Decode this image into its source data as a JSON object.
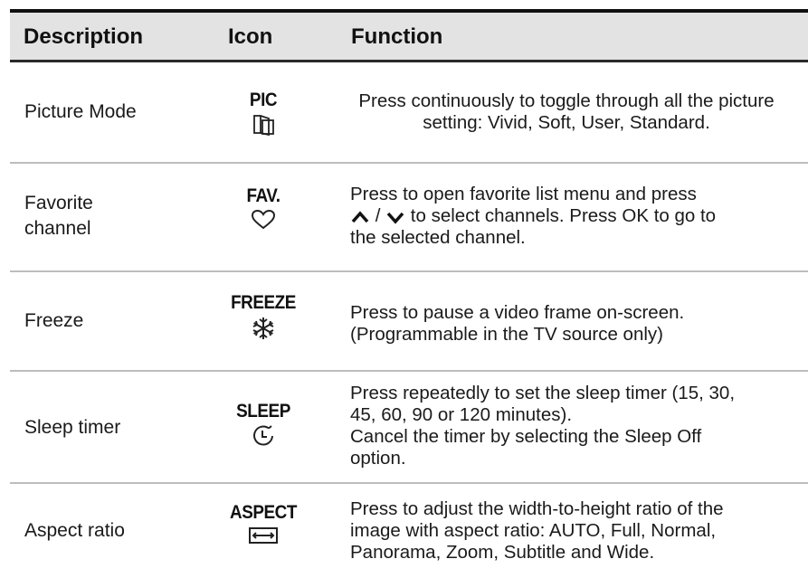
{
  "header": {
    "description": "Description",
    "icon": "Icon",
    "function": "Function"
  },
  "rows": [
    {
      "description": "Picture Mode",
      "icon_label": "PIC",
      "icon_name": "picture-mode-icon",
      "function": "Press continuously to toggle through all the picture setting: Vivid, Soft, User, Standard."
    },
    {
      "description_line1": "Favorite",
      "description_line2": "channel",
      "icon_label": "FAV.",
      "icon_name": "heart-icon",
      "function_line1": "Press to open favorite list menu and press",
      "function_line2_pre": " / ",
      "function_line2_post": " to select channels. Press OK to go to",
      "function_line3": "the selected channel.",
      "up_icon": "chevron-up-icon",
      "down_icon": "chevron-down-icon"
    },
    {
      "description": "Freeze",
      "icon_label": "FREEZE",
      "icon_name": "snowflake-icon",
      "function_line1": "Press to pause a video frame on-screen.",
      "function_line2": "(Programmable in the TV source only)"
    },
    {
      "description": "Sleep timer",
      "icon_label": "SLEEP",
      "icon_name": "sleep-timer-icon",
      "function_line1": "Press repeatedly to set the sleep timer (15, 30,",
      "function_line2": "45, 60, 90 or 120 minutes).",
      "function_line3": "Cancel the timer by selecting the Sleep Off",
      "function_line4": "option."
    },
    {
      "description": "Aspect ratio",
      "icon_label": "ASPECT",
      "icon_name": "aspect-ratio-icon",
      "function_line1": "Press to adjust the width-to-height ratio of the",
      "function_line2": "image with aspect ratio: AUTO, Full, Normal,",
      "function_line3": "Panorama, Zoom, Subtitle and Wide."
    }
  ]
}
